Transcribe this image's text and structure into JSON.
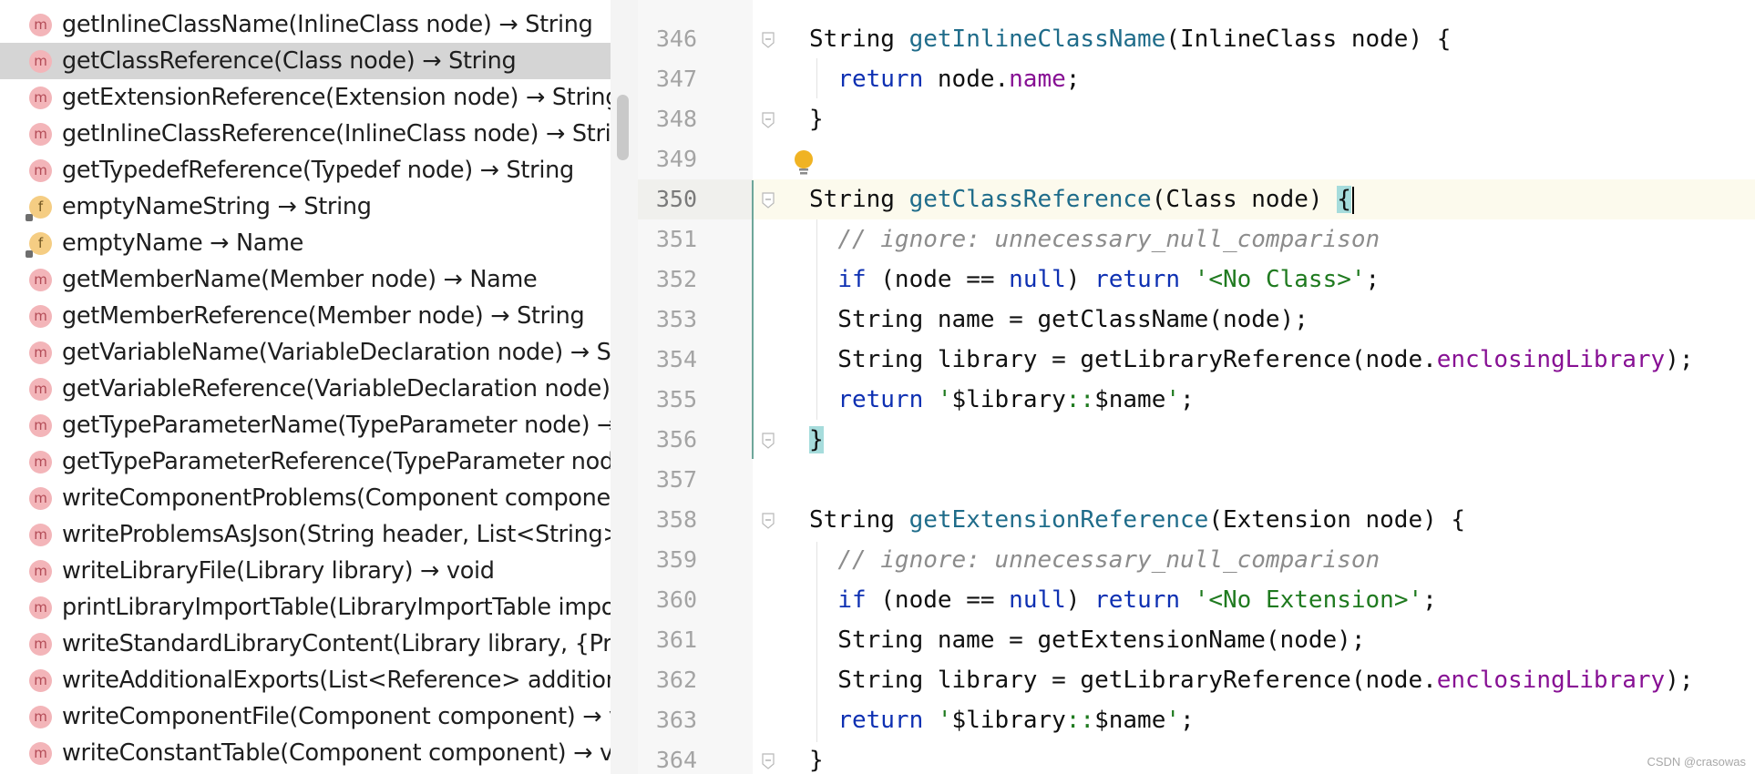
{
  "structure": {
    "members": [
      {
        "kind": "method",
        "label": "getInlineClassName(InlineClass node) → String",
        "selected": false
      },
      {
        "kind": "method",
        "label": "getClassReference(Class node) → String",
        "selected": true
      },
      {
        "kind": "method",
        "label": "getExtensionReference(Extension node) → String",
        "selected": false
      },
      {
        "kind": "method",
        "label": "getInlineClassReference(InlineClass node) → Strin",
        "selected": false
      },
      {
        "kind": "method",
        "label": "getTypedefReference(Typedef node) → String",
        "selected": false
      },
      {
        "kind": "field",
        "label": "emptyNameString → String",
        "selected": false
      },
      {
        "kind": "field",
        "label": "emptyName → Name",
        "selected": false
      },
      {
        "kind": "method",
        "label": "getMemberName(Member node) → Name",
        "selected": false
      },
      {
        "kind": "method",
        "label": "getMemberReference(Member node) → String",
        "selected": false
      },
      {
        "kind": "method",
        "label": "getVariableName(VariableDeclaration node) → Str",
        "selected": false
      },
      {
        "kind": "method",
        "label": "getVariableReference(VariableDeclaration node) →",
        "selected": false
      },
      {
        "kind": "method",
        "label": "getTypeParameterName(TypeParameter node) → S",
        "selected": false
      },
      {
        "kind": "method",
        "label": "getTypeParameterReference(TypeParameter node",
        "selected": false
      },
      {
        "kind": "method",
        "label": "writeComponentProblems(Component component",
        "selected": false
      },
      {
        "kind": "method",
        "label": "writeProblemsAsJson(String header, List<String>?",
        "selected": false
      },
      {
        "kind": "method",
        "label": "writeLibraryFile(Library library) → void",
        "selected": false
      },
      {
        "kind": "method",
        "label": "printLibraryImportTable(LibraryImportTable import",
        "selected": false
      },
      {
        "kind": "method",
        "label": "writeStandardLibraryContent(Library library, {Print",
        "selected": false
      },
      {
        "kind": "method",
        "label": "writeAdditionalExports(List<Reference> additiona",
        "selected": false
      },
      {
        "kind": "method",
        "label": "writeComponentFile(Component component) → vo",
        "selected": false
      },
      {
        "kind": "method",
        "label": "writeConstantTable(Component component) → vo",
        "selected": false
      }
    ],
    "method_icon_letter": "m",
    "field_icon_letter": "f"
  },
  "editor": {
    "current_line": "350",
    "lines": [
      {
        "n": "346",
        "fold": true,
        "tokens": [
          [
            "plain",
            "String "
          ],
          [
            "fn",
            "getInlineClassName"
          ],
          [
            "plain",
            "(InlineClass node) {"
          ]
        ]
      },
      {
        "n": "347",
        "tokens": [
          [
            "plain",
            "  "
          ],
          [
            "kw",
            "return"
          ],
          [
            "plain",
            " node."
          ],
          [
            "fld",
            "name"
          ],
          [
            "plain",
            ";"
          ]
        ]
      },
      {
        "n": "348",
        "fold": true,
        "tokens": [
          [
            "plain",
            "}"
          ]
        ]
      },
      {
        "n": "349",
        "tokens": []
      },
      {
        "n": "350",
        "fold": true,
        "tokens": [
          [
            "plain",
            "String "
          ],
          [
            "fn",
            "getClassReference"
          ],
          [
            "plain",
            "(Class node) "
          ],
          [
            "brace",
            "{"
          ],
          [
            "caret",
            ""
          ]
        ]
      },
      {
        "n": "351",
        "tokens": [
          [
            "plain",
            "  "
          ],
          [
            "cmt",
            "// ignore: unnecessary_null_comparison"
          ]
        ]
      },
      {
        "n": "352",
        "tokens": [
          [
            "plain",
            "  "
          ],
          [
            "kw",
            "if"
          ],
          [
            "plain",
            " (node == "
          ],
          [
            "kw",
            "null"
          ],
          [
            "plain",
            ") "
          ],
          [
            "kw",
            "return"
          ],
          [
            "plain",
            " "
          ],
          [
            "str",
            "'<No Class>'"
          ],
          [
            "plain",
            ";"
          ]
        ]
      },
      {
        "n": "353",
        "tokens": [
          [
            "plain",
            "  String name = getClassName(node);"
          ]
        ]
      },
      {
        "n": "354",
        "tokens": [
          [
            "plain",
            "  String library = getLibraryReference(node."
          ],
          [
            "fld",
            "enclosingLibrary"
          ],
          [
            "plain",
            ");"
          ]
        ]
      },
      {
        "n": "355",
        "tokens": [
          [
            "plain",
            "  "
          ],
          [
            "kw",
            "return"
          ],
          [
            "plain",
            " "
          ],
          [
            "str",
            "'"
          ],
          [
            "plain",
            "$library"
          ],
          [
            "str",
            "::"
          ],
          [
            "plain",
            "$name"
          ],
          [
            "str",
            "'"
          ],
          [
            "plain",
            ";"
          ]
        ]
      },
      {
        "n": "356",
        "fold": true,
        "tokens": [
          [
            "brace",
            "}"
          ]
        ]
      },
      {
        "n": "357",
        "tokens": []
      },
      {
        "n": "358",
        "fold": true,
        "tokens": [
          [
            "plain",
            "String "
          ],
          [
            "fn",
            "getExtensionReference"
          ],
          [
            "plain",
            "(Extension node) {"
          ]
        ]
      },
      {
        "n": "359",
        "tokens": [
          [
            "plain",
            "  "
          ],
          [
            "cmt",
            "// ignore: unnecessary_null_comparison"
          ]
        ]
      },
      {
        "n": "360",
        "tokens": [
          [
            "plain",
            "  "
          ],
          [
            "kw",
            "if"
          ],
          [
            "plain",
            " (node == "
          ],
          [
            "kw",
            "null"
          ],
          [
            "plain",
            ") "
          ],
          [
            "kw",
            "return"
          ],
          [
            "plain",
            " "
          ],
          [
            "str",
            "'<No Extension>'"
          ],
          [
            "plain",
            ";"
          ]
        ]
      },
      {
        "n": "361",
        "tokens": [
          [
            "plain",
            "  String name = getExtensionName(node);"
          ]
        ]
      },
      {
        "n": "362",
        "tokens": [
          [
            "plain",
            "  String library = getLibraryReference(node."
          ],
          [
            "fld",
            "enclosingLibrary"
          ],
          [
            "plain",
            ");"
          ]
        ]
      },
      {
        "n": "363",
        "tokens": [
          [
            "plain",
            "  "
          ],
          [
            "kw",
            "return"
          ],
          [
            "plain",
            " "
          ],
          [
            "str",
            "'"
          ],
          [
            "plain",
            "$library"
          ],
          [
            "str",
            "::"
          ],
          [
            "plain",
            "$name"
          ],
          [
            "str",
            "'"
          ],
          [
            "plain",
            ";"
          ]
        ]
      },
      {
        "n": "364",
        "fold": true,
        "tokens": [
          [
            "plain",
            "}"
          ]
        ]
      }
    ]
  },
  "watermark": "CSDN @crasowas",
  "colors": {
    "keyword": "#0e30b2",
    "function": "#1f6c8a",
    "field": "#871094",
    "string": "#1f7a1f",
    "comment": "#8c8c8c",
    "brace_match": "#a6dcdc",
    "selected_row": "#d5d5d5"
  }
}
